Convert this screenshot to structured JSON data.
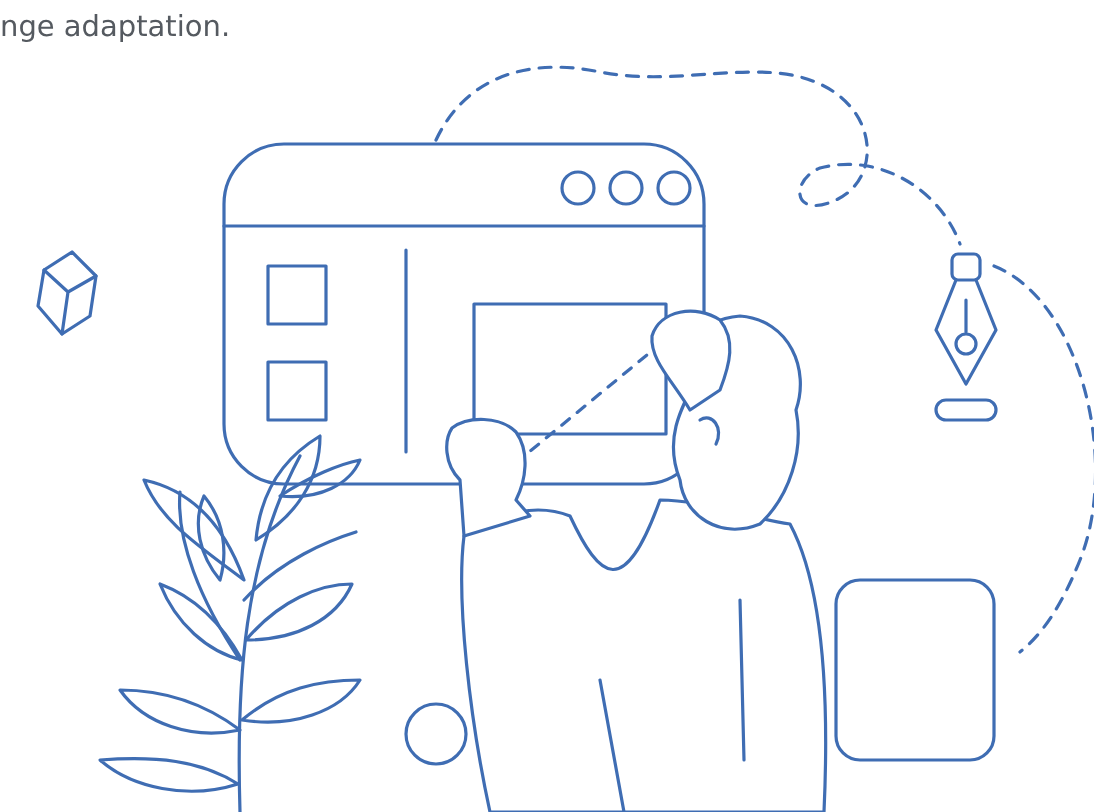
{
  "intro": {
    "text": "nge adaptation."
  }
}
